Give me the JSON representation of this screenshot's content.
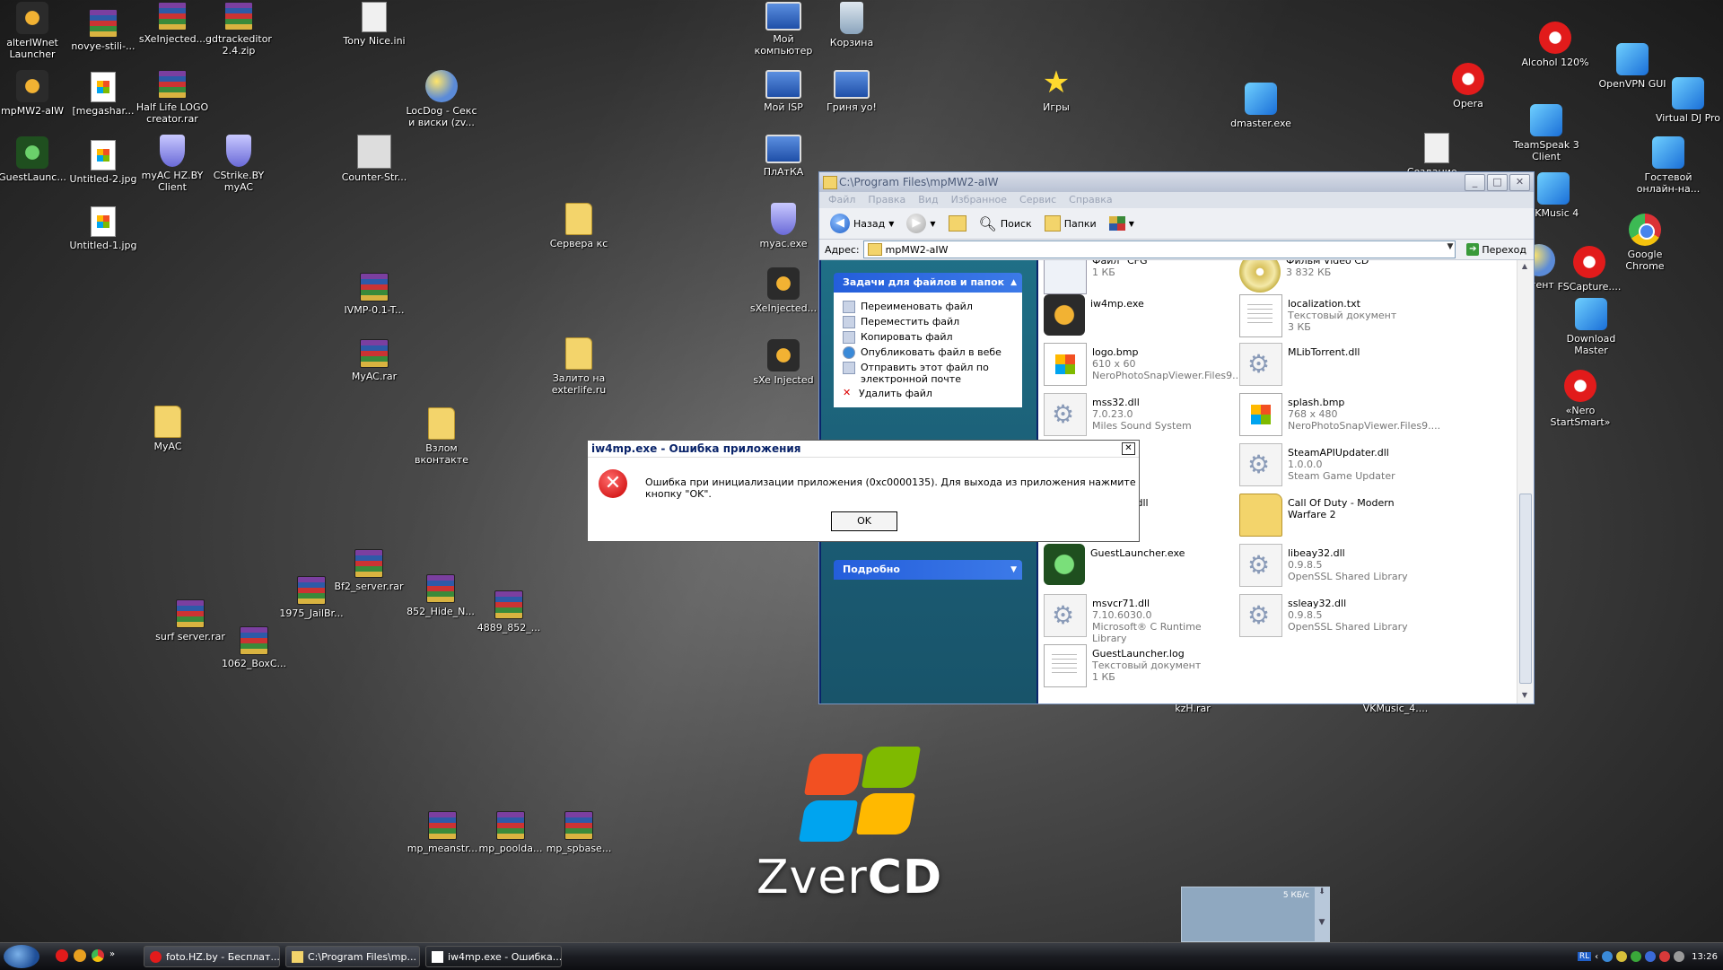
{
  "desktop_icons": [
    {
      "label": "alterIWnet Launcher",
      "icon": "game-icon"
    },
    {
      "label": "novye-stili-...",
      "icon": "rar-icon"
    },
    {
      "label": "sXeInjected...",
      "icon": "rar-icon"
    },
    {
      "label": "gdtrackeditor 2.4.zip",
      "icon": "rar-icon"
    },
    {
      "label": "Tony Nice.ini",
      "icon": "ini-icon"
    },
    {
      "label": "Мой компьютер",
      "icon": "computer-icon"
    },
    {
      "label": "Корзина",
      "icon": "recycle-bin-icon"
    },
    {
      "label": "mpMW2-aIW",
      "icon": "game-icon"
    },
    {
      "label": "[megashar...",
      "icon": "image-icon"
    },
    {
      "label": "Half Life LOGO creator.rar",
      "icon": "rar-icon"
    },
    {
      "label": "LocDog - Секс и виски (zv...",
      "icon": "media-icon"
    },
    {
      "label": "Мой ISP",
      "icon": "network-icon"
    },
    {
      "label": "Гриня yo!",
      "icon": "network-icon"
    },
    {
      "label": "Игры",
      "icon": "star-icon"
    },
    {
      "label": "dmaster.exe",
      "icon": "download-icon"
    },
    {
      "label": "Opera",
      "icon": "opera-icon"
    },
    {
      "label": "Alcohol 120%",
      "icon": "alcohol-icon"
    },
    {
      "label": "OpenVPN GUI",
      "icon": "vpn-icon"
    },
    {
      "label": "Virtual DJ Pro",
      "icon": "dj-icon"
    },
    {
      "label": "GuestLaunc...",
      "icon": "game-green-icon"
    },
    {
      "label": "Untitled-2.jpg",
      "icon": "image-icon"
    },
    {
      "label": "myAC HZ.BY Client",
      "icon": "shield-icon"
    },
    {
      "label": "CStrike.BY myAC",
      "icon": "shield-icon"
    },
    {
      "label": "Counter-Str...",
      "icon": "cs-icon"
    },
    {
      "label": "ПлАтКА",
      "icon": "network-icon"
    },
    {
      "label": "Создание...",
      "icon": "document-icon"
    },
    {
      "label": "TeamSpeak 3 Client",
      "icon": "teamspeak-icon"
    },
    {
      "label": "Гостевой онлайн-на...",
      "icon": "guest-icon"
    },
    {
      "label": "Untitled-1.jpg",
      "icon": "image-icon"
    },
    {
      "label": "Сервера кс",
      "icon": "folder-icon"
    },
    {
      "label": "myac.exe",
      "icon": "shield-icon"
    },
    {
      "label": "VKMusic 4",
      "icon": "vkmusic-icon"
    },
    {
      "label": "Google Chrome",
      "icon": "chrome-icon"
    },
    {
      "label": "IVMP-0.1-T...",
      "icon": "rar-icon"
    },
    {
      "label": "sXeInjected...",
      "icon": "sxe-icon"
    },
    {
      "label": "Агент",
      "icon": "agent-icon"
    },
    {
      "label": "FSCapture....",
      "icon": "capture-icon"
    },
    {
      "label": "Download Master",
      "icon": "download-icon"
    },
    {
      "label": "MyAC.rar",
      "icon": "rar-icon"
    },
    {
      "label": "Залито на exterlife.ru",
      "icon": "folder-icon"
    },
    {
      "label": "sXe Injected",
      "icon": "sxe-icon"
    },
    {
      "label": "«Nero StartSmart»",
      "icon": "nero-icon"
    },
    {
      "label": "MyAC",
      "icon": "folder-icon"
    },
    {
      "label": "Взлом вконтакте",
      "icon": "folder-icon"
    },
    {
      "label": "Bf2_server.rar",
      "icon": "rar-icon"
    },
    {
      "label": "1975_JailBr...",
      "icon": "rar-icon"
    },
    {
      "label": "852_Hide_N...",
      "icon": "rar-icon"
    },
    {
      "label": "4889_852_...",
      "icon": "rar-icon"
    },
    {
      "label": "surf server.rar",
      "icon": "rar-icon"
    },
    {
      "label": "1062_BoxC...",
      "icon": "rar-icon"
    },
    {
      "label": "kzH.rar",
      "icon": "rar-icon"
    },
    {
      "label": "VKMusic_4....",
      "icon": "rar-icon"
    },
    {
      "label": "mp_meanstr...",
      "icon": "rar-icon"
    },
    {
      "label": "mp_poolda...",
      "icon": "rar-icon"
    },
    {
      "label": "mp_spbase...",
      "icon": "rar-icon"
    }
  ],
  "explorer": {
    "title": "C:\\Program Files\\mpMW2-aIW",
    "menu": [
      "Файл",
      "Правка",
      "Вид",
      "Избранное",
      "Сервис",
      "Справка"
    ],
    "toolbar": {
      "back": "Назад",
      "search": "Поиск",
      "folders": "Папки"
    },
    "address_label": "Адрес:",
    "address_value": "mpMW2-aIW",
    "go_label": "Переход",
    "tasks_header": "Задачи для файлов и папок",
    "tasks": [
      "Переименовать файл",
      "Переместить файл",
      "Копировать файл",
      "Опубликовать файл в вебе",
      "Отправить этот файл по электронной почте",
      "Удалить файл"
    ],
    "details_header": "Подробно",
    "files_left": [
      {
        "name": "Файл \"CFG\"",
        "sub1": "1 КБ",
        "sub2": "",
        "type": "cfg"
      },
      {
        "name": "iw4mp.exe",
        "sub1": "",
        "sub2": "",
        "type": "exe2"
      },
      {
        "name": "logo.bmp",
        "sub1": "610 x 60",
        "sub2": "NeroPhotoSnapViewer.Files9....",
        "type": "bmp"
      },
      {
        "name": "mss32.dll",
        "sub1": "7.0.23.0",
        "sub2": "Miles Sound System",
        "type": "dll"
      },
      {
        "name": "",
        "sub1": "",
        "sub2": "",
        "type": "dll"
      },
      {
        "name": "...rapper.dll",
        "sub1": "",
        "sub2": "",
        "type": "dll"
      },
      {
        "name": "GuestLauncher.exe",
        "sub1": "",
        "sub2": "",
        "type": "green2"
      },
      {
        "name": "msvcr71.dll",
        "sub1": "7.10.6030.0",
        "sub2": "Microsoft® C Runtime Library",
        "type": "dll"
      },
      {
        "name": "GuestLauncher.log",
        "sub1": "Текстовый документ",
        "sub2": "1 КБ",
        "type": "txtf"
      }
    ],
    "files_right": [
      {
        "name": "Фильм Video CD",
        "sub1": "3 832 КБ",
        "sub2": "",
        "type": "cd"
      },
      {
        "name": "localization.txt",
        "sub1": "Текстовый документ",
        "sub2": "3 КБ",
        "type": "txtf"
      },
      {
        "name": "MLibTorrent.dll",
        "sub1": "",
        "sub2": "",
        "type": "dll"
      },
      {
        "name": "splash.bmp",
        "sub1": "768 x 480",
        "sub2": "NeroPhotoSnapViewer.Files9....",
        "type": "bmp"
      },
      {
        "name": "SteamAPIUpdater.dll",
        "sub1": "1.0.0.0",
        "sub2": "Steam Game Updater",
        "type": "dll"
      },
      {
        "name": "Call Of Duty - Modern Warfare 2",
        "sub1": "",
        "sub2": "",
        "type": "folder"
      },
      {
        "name": "libeay32.dll",
        "sub1": "0.9.8.5",
        "sub2": "OpenSSL Shared Library",
        "type": "dll"
      },
      {
        "name": "ssleay32.dll",
        "sub1": "0.9.8.5",
        "sub2": "OpenSSL Shared Library",
        "type": "dll"
      }
    ]
  },
  "dialog": {
    "title": "iw4mp.exe - Ошибка приложения",
    "message": "Ошибка при инициализации приложения (0xc0000135). Для выхода из приложения нажмите кнопку \"OK\".",
    "ok_label": "OK"
  },
  "wallpaper": {
    "brand_light": "Zver",
    "brand_bold": "CD"
  },
  "meter": {
    "text": "5 КБ/с"
  },
  "taskbar": {
    "buttons": [
      {
        "label": "foto.HZ.by - Бесплат...",
        "icon": "opera-icon"
      },
      {
        "label": "C:\\Program Files\\mp...",
        "icon": "folder-icon"
      },
      {
        "label": "iw4mp.exe - Ошибка...",
        "icon": "window-icon"
      }
    ],
    "lang": "RL",
    "clock": "13:26"
  },
  "colors": {
    "accent": "#245edb",
    "error": "#c80000",
    "panel": "#1f6f86"
  }
}
